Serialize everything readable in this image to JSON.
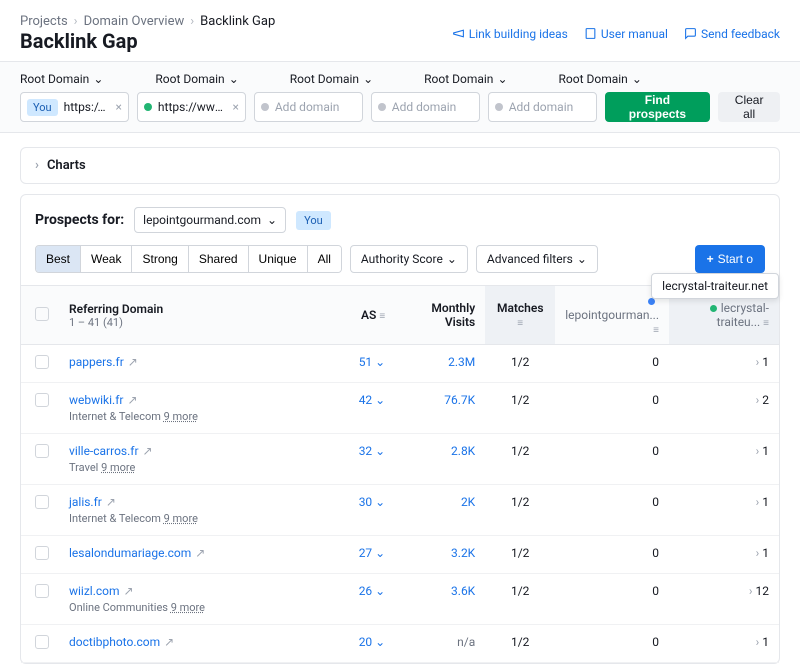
{
  "breadcrumbs": [
    "Projects",
    "Domain Overview",
    "Backlink Gap"
  ],
  "title": "Backlink Gap",
  "topLinks": {
    "ideas": "Link building ideas",
    "manual": "User manual",
    "feedback": "Send feedback"
  },
  "rootDomainLabel": "Root Domain",
  "domains": {
    "you": "https://lep...",
    "comp1": "https://www.l...",
    "placeholder": "Add domain"
  },
  "buttons": {
    "find": "Find prospects",
    "clear": "Clear all",
    "outreach": "Start o"
  },
  "charts": "Charts",
  "prospects": {
    "label": "Prospects for:",
    "domain": "lepointgourmand.com",
    "you": "You"
  },
  "tabs": [
    "Best",
    "Weak",
    "Strong",
    "Shared",
    "Unique",
    "All"
  ],
  "filters": {
    "authority": "Authority Score",
    "advanced": "Advanced filters"
  },
  "tooltip": "lecrystal-traiteur.net",
  "cols": {
    "refdom": "Referring Domain",
    "range": "1 – 41 (41)",
    "as": "AS",
    "mv": "Monthly Visits",
    "matches": "Matches",
    "c1": "lepointgourman...",
    "c2": "lecrystal-traiteu..."
  },
  "rows": [
    {
      "domain": "pappers.fr",
      "cat": "",
      "as": "51",
      "mv": "2.3M",
      "matches": "1/2",
      "v1": "0",
      "v2": "1"
    },
    {
      "domain": "webwiki.fr",
      "cat": "Internet & Telecom 9 more",
      "as": "42",
      "mv": "76.7K",
      "matches": "1/2",
      "v1": "0",
      "v2": "2"
    },
    {
      "domain": "ville-carros.fr",
      "cat": "Travel 9 more",
      "as": "32",
      "mv": "2.8K",
      "matches": "1/2",
      "v1": "0",
      "v2": "1"
    },
    {
      "domain": "jalis.fr",
      "cat": "Internet & Telecom 9 more",
      "as": "30",
      "mv": "2K",
      "matches": "1/2",
      "v1": "0",
      "v2": "1"
    },
    {
      "domain": "lesalondumariage.com",
      "cat": "",
      "as": "27",
      "mv": "3.2K",
      "matches": "1/2",
      "v1": "0",
      "v2": "1"
    },
    {
      "domain": "wiizl.com",
      "cat": "Online Communities 9 more",
      "as": "26",
      "mv": "3.6K",
      "matches": "1/2",
      "v1": "0",
      "v2": "12"
    },
    {
      "domain": "doctibphoto.com",
      "cat": "",
      "as": "20",
      "mv": "n/a",
      "matches": "1/2",
      "v1": "0",
      "v2": "1"
    }
  ]
}
